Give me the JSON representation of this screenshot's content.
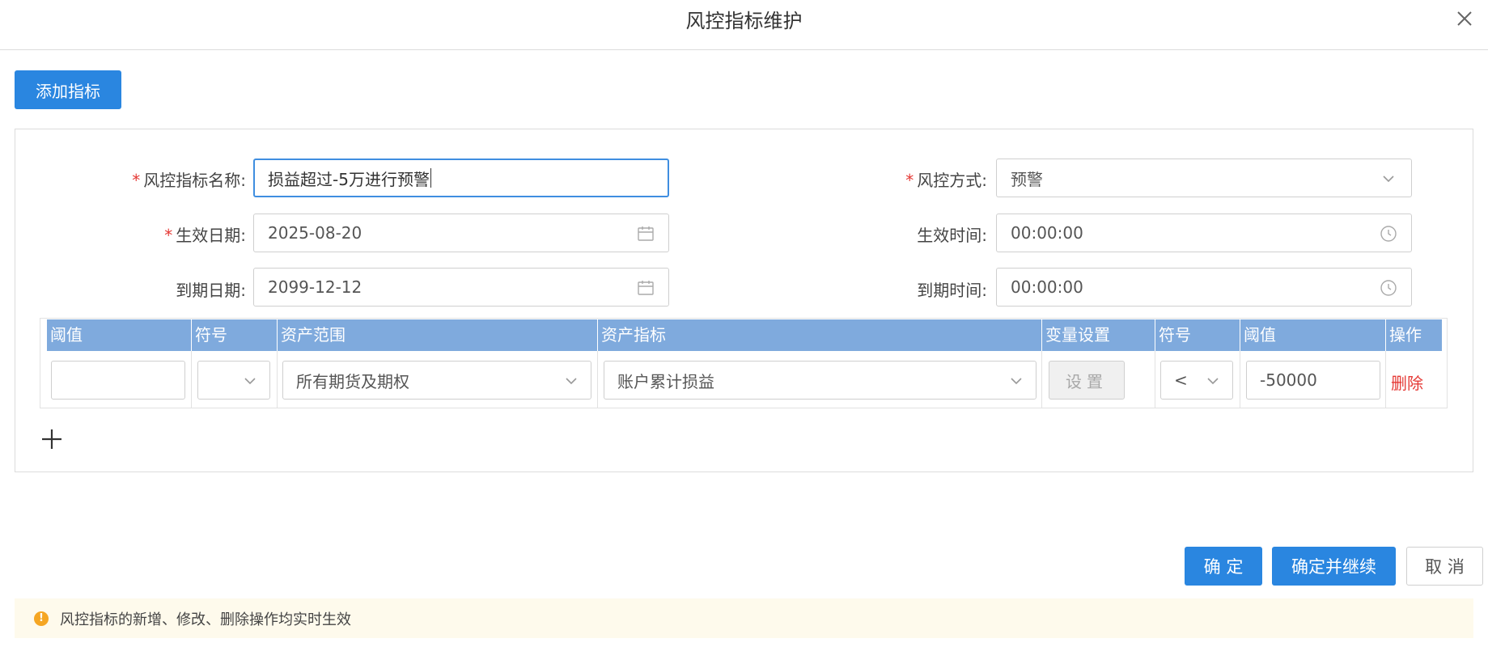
{
  "dialog": {
    "title": "风控指标维护",
    "close_icon": "close-icon"
  },
  "toolbar": {
    "add_label": "添加指标"
  },
  "form": {
    "name_label": "风控指标名称:",
    "name_value": "损益超过-5万进行预警",
    "method_label": "风控方式:",
    "method_value": "预警",
    "effective_date_label": "生效日期:",
    "effective_date_value": "2025-08-20",
    "effective_time_label": "生效时间:",
    "effective_time_value": "00:00:00",
    "expire_date_label": "到期日期:",
    "expire_date_value": "2099-12-12",
    "expire_time_label": "到期时间:",
    "expire_time_value": "00:00:00",
    "required_mark": "*"
  },
  "grid": {
    "columns": [
      "阈值",
      "符号",
      "资产范围",
      "资产指标",
      "变量设置",
      "符号",
      "阈值",
      "操作"
    ],
    "row": {
      "threshold_left": "",
      "symbol_left": "",
      "asset_scope": "所有期货及期权",
      "asset_indicator": "账户累计损益",
      "set_label": "设置",
      "symbol_right": "<",
      "threshold_right": "-50000",
      "delete_label": "删除"
    }
  },
  "footer": {
    "confirm_label": "确 定",
    "confirm_continue_label": "确定并继续",
    "cancel_label": "取 消"
  },
  "notice": {
    "icon": "warning-icon",
    "text": "风控指标的新增、修改、删除操作均实时生效"
  },
  "colors": {
    "primary": "#2a86e0",
    "header_bg": "#7faadd",
    "danger": "#e53935",
    "notice_bg": "#fefaec",
    "warn": "#f5a623"
  }
}
